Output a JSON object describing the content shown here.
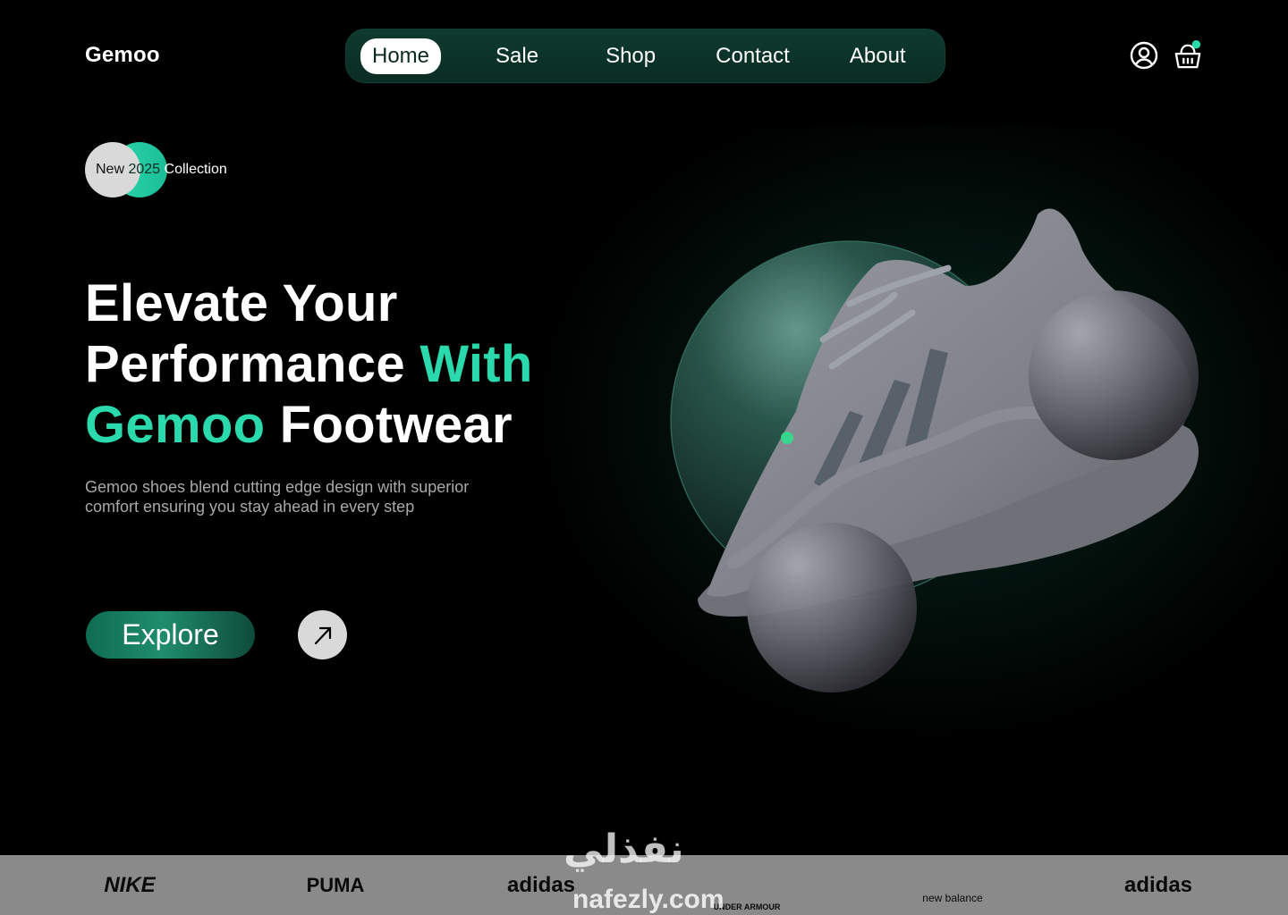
{
  "brand": {
    "name": "Gemoo"
  },
  "nav": {
    "items": [
      "Home",
      "Sale",
      "Shop",
      "Contact",
      "About"
    ],
    "active": "Home"
  },
  "header_icons": [
    "user-circle-icon",
    "shopping-basket-icon"
  ],
  "badge": {
    "new": "New",
    "year": "2025",
    "collection": "Collection"
  },
  "hero": {
    "line1": "Elevate Your",
    "line2_plain": "Performance ",
    "line2_accent": "With",
    "line3_accent": "Gemoo",
    "line3_plain": " Footwear",
    "description": "Gemoo shoes blend cutting edge design with superior comfort ensuring you stay ahead in every step",
    "cta_label": "Explore",
    "cta_icon": "arrow-up-right-icon"
  },
  "brands": [
    "NIKE",
    "PUMA",
    "adidas",
    "UNDER ARMOUR",
    "new balance",
    "adidas"
  ],
  "watermark": {
    "arabic": "نفذلي",
    "latin": "nafezly.com"
  },
  "colors": {
    "accent": "#2ad9ac",
    "nav_bg": "#0f3a2e",
    "background": "#000000",
    "brand_bar": "#8a8a8a"
  }
}
